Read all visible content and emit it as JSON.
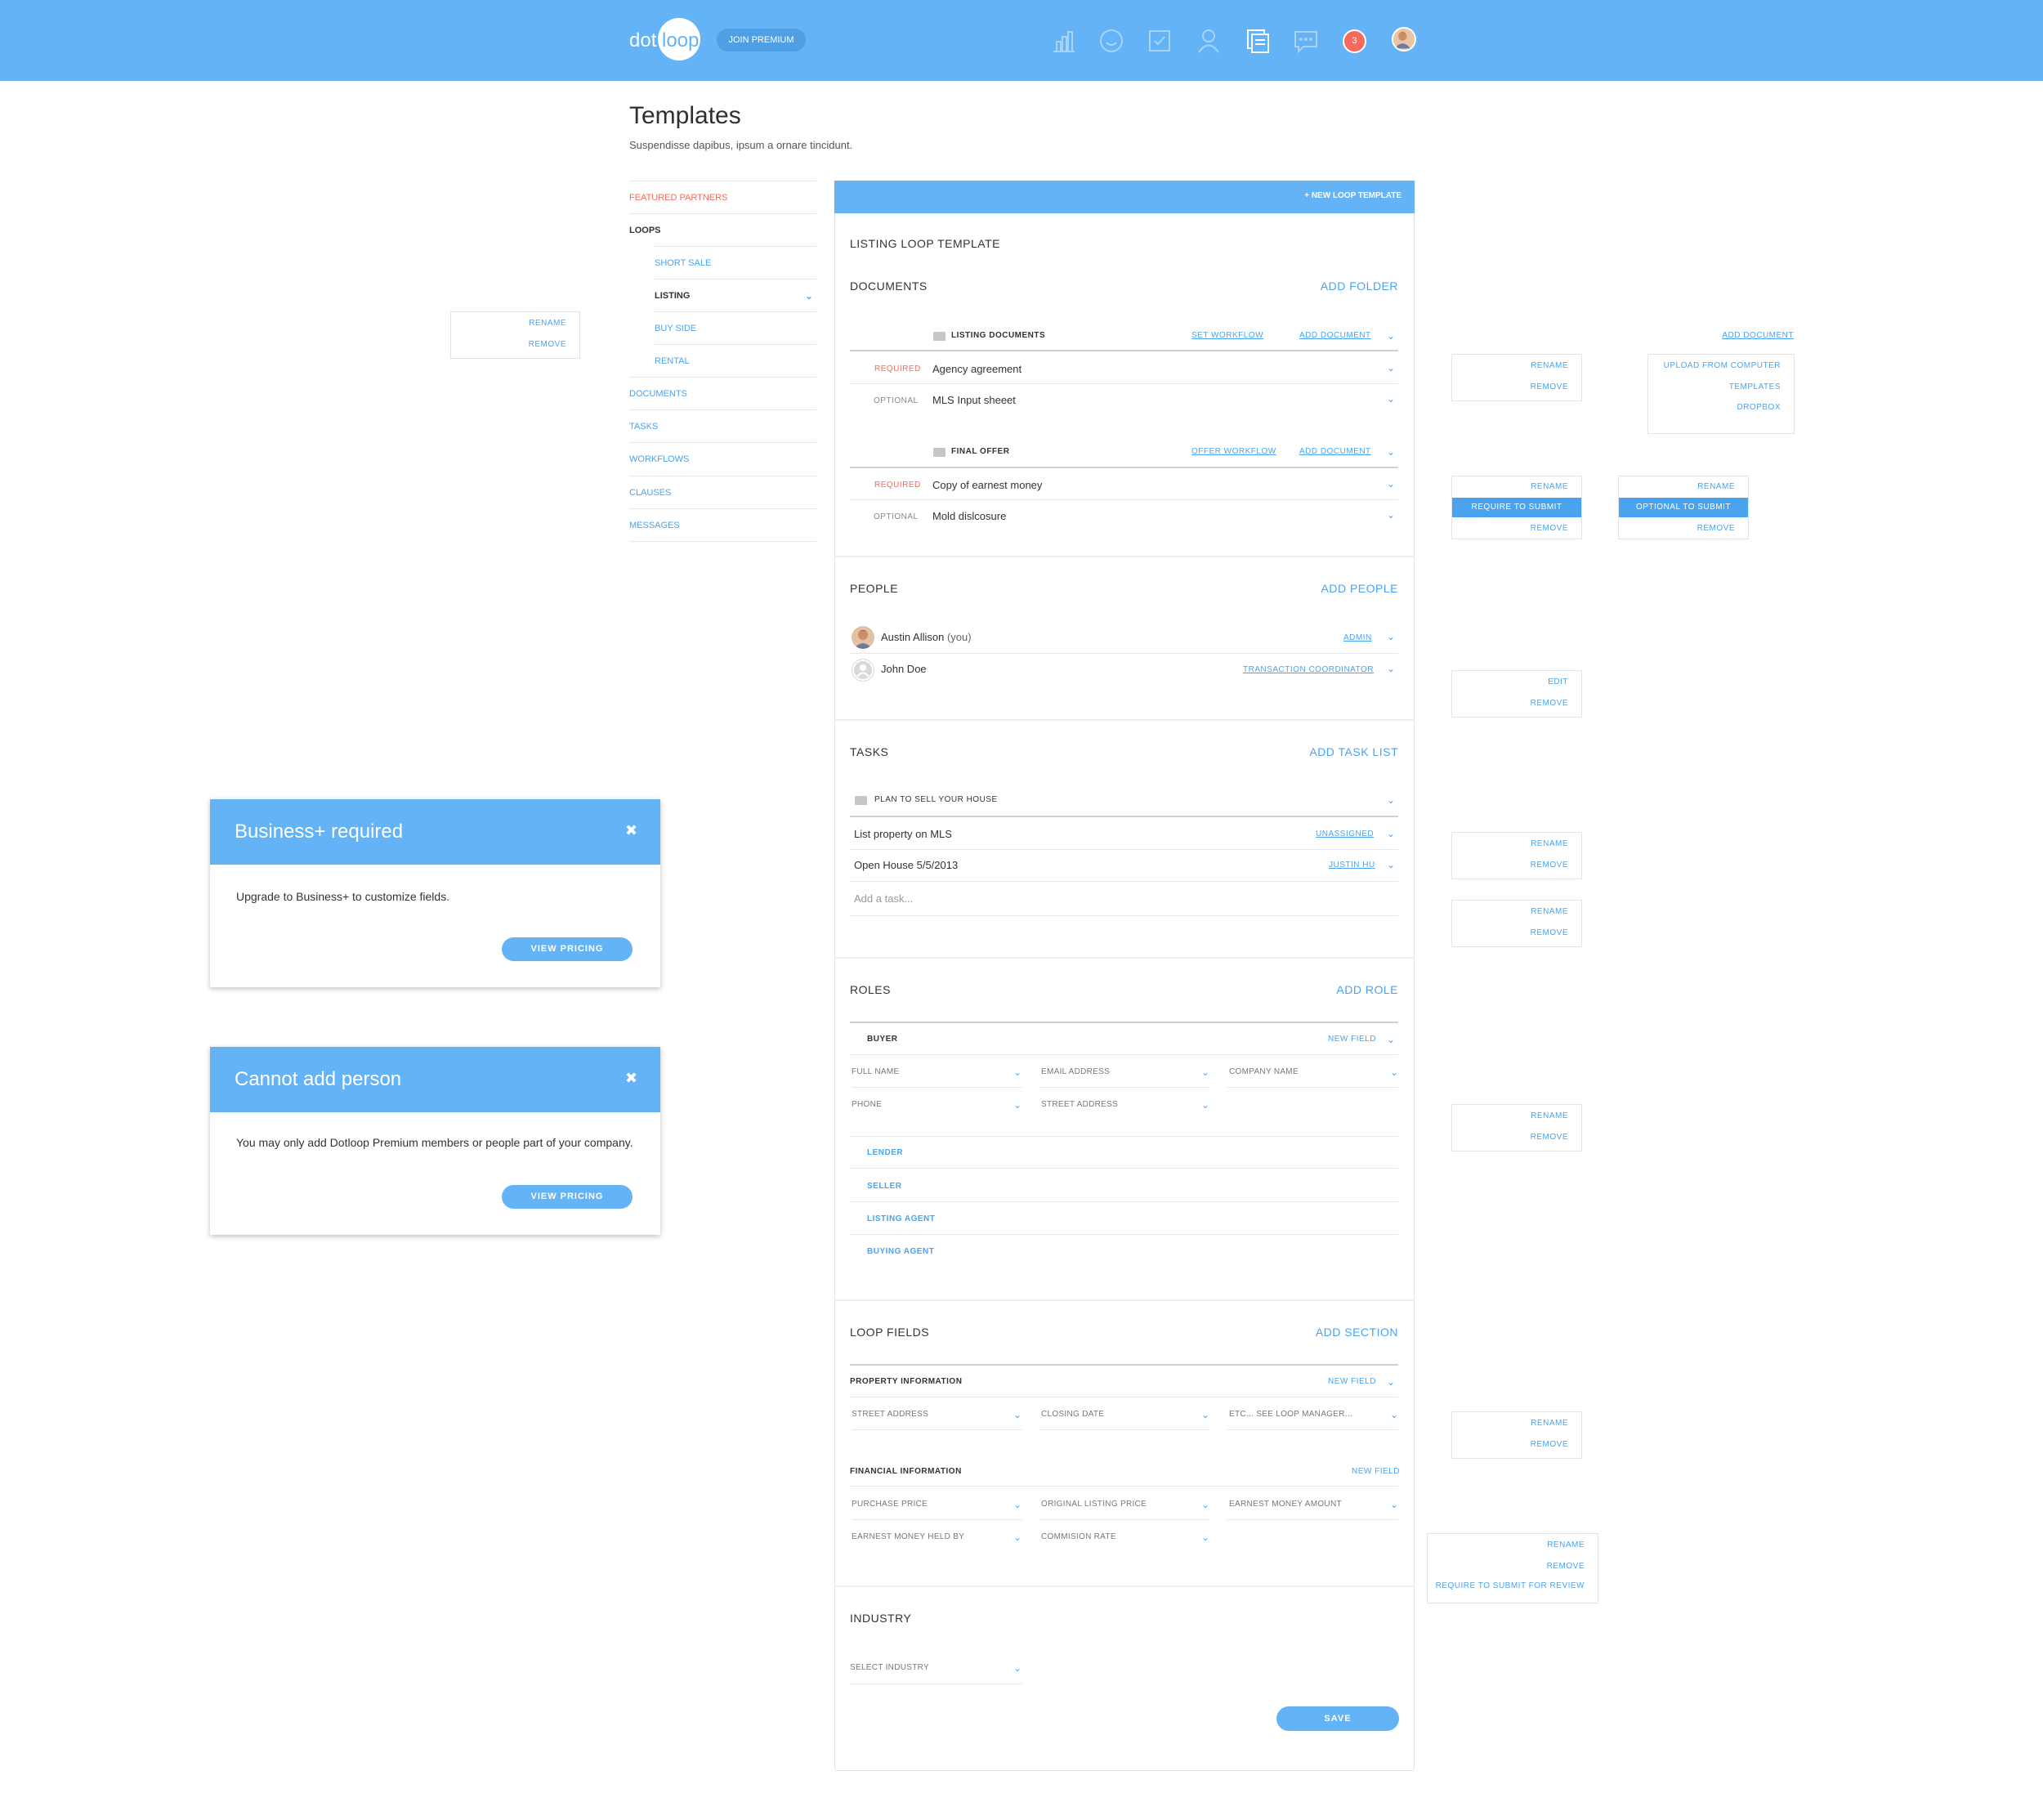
{
  "header": {
    "logo_dot": "dot",
    "logo_loop": "loop",
    "join_premium": "JOIN PREMIUM",
    "notification_count": "3"
  },
  "page": {
    "title": "Templates",
    "subtitle": "Suspendisse dapibus, ipsum a ornare tincidunt."
  },
  "sidebar": {
    "featured_partners": "FEATURED PARTNERS",
    "loops": "LOOPS",
    "short_sale": "SHORT SALE",
    "listing": "LISTING",
    "buy_side": "BUY SIDE",
    "rental": "RENTAL",
    "documents": "DOCUMENTS",
    "tasks": "TASKS",
    "workflows": "WORKFLOWS",
    "clauses": "CLAUSES",
    "messages": "MESSAGES"
  },
  "card": {
    "new_loop_template": "NEW LOOP TEMPLATE",
    "template_name": "LISTING LOOP TEMPLATE",
    "save": "SAVE"
  },
  "documents": {
    "title": "DOCUMENTS",
    "add": "ADD FOLDER",
    "folders": [
      {
        "name": "LISTING DOCUMENTS",
        "workflow": "SET WORKFLOW",
        "add_document": "ADD DOCUMENT",
        "items": [
          {
            "tag": "REQUIRED",
            "name": "Agency agreement"
          },
          {
            "tag": "OPTIONAL",
            "name": "MLS Input sheeet"
          }
        ]
      },
      {
        "name": "FINAL OFFER",
        "workflow": "OFFER WORKFLOW",
        "add_document": "ADD DOCUMENT",
        "items": [
          {
            "tag": "REQUIRED",
            "name": "Copy of earnest money"
          },
          {
            "tag": "OPTIONAL",
            "name": "Mold dislcosure"
          }
        ]
      }
    ]
  },
  "people": {
    "title": "PEOPLE",
    "add": "ADD PEOPLE",
    "list": [
      {
        "name": "Austin Allison",
        "suffix": "(you)",
        "role": "ADMIN"
      },
      {
        "name": "John Doe",
        "suffix": "",
        "role": "TRANSACTION COORDINATOR"
      }
    ]
  },
  "tasks": {
    "title": "TASKS",
    "add": "ADD TASK LIST",
    "list_name": "PLAN TO SELL YOUR HOUSE",
    "items": [
      {
        "name": "List property on MLS",
        "assignee": "UNASSIGNED"
      },
      {
        "name": "Open House 5/5/2013",
        "assignee": "JUSTIN HU"
      }
    ],
    "add_placeholder": "Add a task..."
  },
  "roles": {
    "title": "ROLES",
    "add": "ADD ROLE",
    "buyer": "BUYER",
    "new_field": "NEW FIELD",
    "fields": [
      "FULL NAME",
      "EMAIL ADDRESS",
      "COMPANY NAME",
      "PHONE",
      "STREET ADDRESS"
    ],
    "others": [
      "LENDER",
      "SELLER",
      "LISTING AGENT",
      "BUYING AGENT"
    ]
  },
  "loop_fields": {
    "title": "LOOP FIELDS",
    "add": "ADD SECTION",
    "property": "PROPERTY INFORMATION",
    "property_fields": [
      "STREET ADDRESS",
      "CLOSING DATE",
      "ETC... SEE LOOP MANAGER..."
    ],
    "financial": "FINANCIAL INFORMATION",
    "financial_fields": [
      "PURCHASE PRICE",
      "ORIGINAL LISTING PRICE",
      "EARNEST MONEY AMOUNT",
      "EARNEST MONEY HELD BY",
      "COMMISION RATE"
    ],
    "new_field": "NEW FIELD"
  },
  "industry": {
    "title": "INDUSTRY",
    "select": "SELECT INDUSTRY"
  },
  "modals": [
    {
      "title": "Business+ required",
      "body": "Upgrade to Business+ to customize fields.",
      "button": "VIEW PRICING"
    },
    {
      "title": "Cannot add person",
      "body": "You may only add Dotloop Premium members or people part of your company.",
      "button": "VIEW PRICING"
    }
  ],
  "menus": {
    "rename": "RENAME",
    "remove": "REMOVE",
    "edit": "EDIT",
    "require_to_submit": "REQUIRE TO SUBMIT",
    "optional_to_submit": "OPTIONAL TO SUBMIT",
    "add_document": "ADD DOCUMENT",
    "upload": "UPLOAD FROM COMPUTER",
    "templates": "TEMPLATES",
    "dropbox": "DROPBOX",
    "require_review": "REQUIRE TO SUBMIT FOR REVIEW"
  },
  "colors": {
    "primary": "#63b3f6",
    "link": "#4aa3ef",
    "alert": "#f56a5c"
  }
}
